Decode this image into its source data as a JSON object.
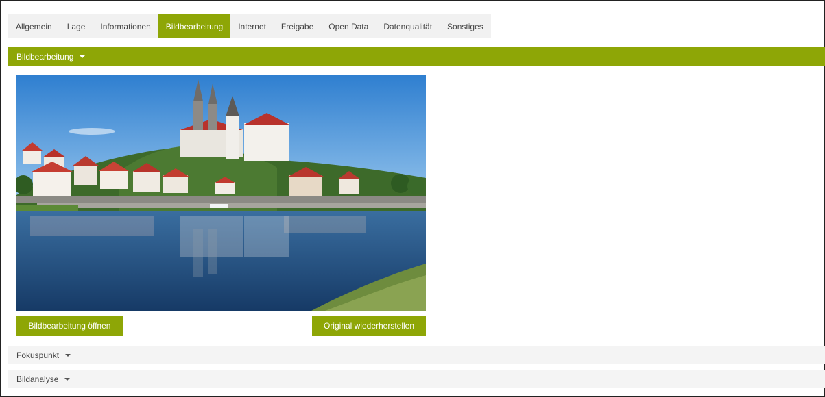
{
  "tabs": [
    {
      "label": "Allgemein"
    },
    {
      "label": "Lage"
    },
    {
      "label": "Informationen"
    },
    {
      "label": "Bildbearbeitung",
      "active": true
    },
    {
      "label": "Internet"
    },
    {
      "label": "Freigabe"
    },
    {
      "label": "Open Data"
    },
    {
      "label": "Datenqualität"
    },
    {
      "label": "Sonstiges"
    }
  ],
  "panel": {
    "title": "Bildbearbeitung",
    "open_button": "Bildbearbeitung öffnen",
    "restore_button": "Original wiederherstellen"
  },
  "sections": {
    "focus_point": "Fokuspunkt",
    "image_analysis": "Bildanalyse"
  },
  "colors": {
    "accent": "#8ea606",
    "tab_bar": "#f1f1f1",
    "section_bg": "#f4f4f4"
  }
}
